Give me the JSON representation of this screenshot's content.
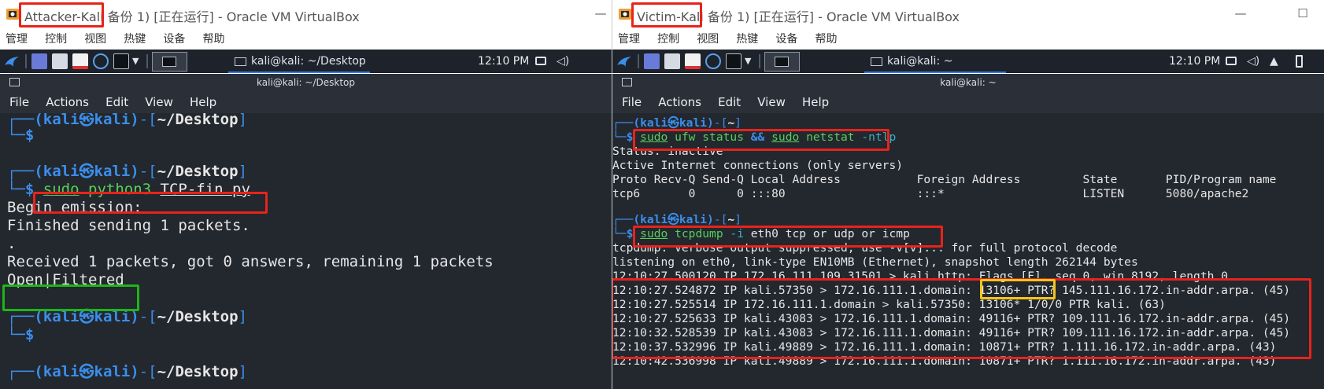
{
  "left_vm": {
    "title_name": "Attacker-Kali",
    "title_rest": " 备份 1) [正在运行] - Oracle VM VirtualBox",
    "menu": [
      "管理",
      "控制",
      "视图",
      "热键",
      "设备",
      "帮助"
    ],
    "panel": {
      "window_tab": "kali@kali: ~/Desktop",
      "clock": "12:10 PM"
    },
    "terminal": {
      "title": "kali@kali: ~/Desktop",
      "menu": [
        "File",
        "Actions",
        "Edit",
        "View",
        "Help"
      ],
      "prompt_user": "(kali㉿kali)",
      "prompt_path": "~/Desktop",
      "prompt_dollar": "$",
      "cmd_sudo": "sudo",
      "cmd_python": " python3 ",
      "cmd_file": "TCP-fin.py",
      "out1": "Begin emission:",
      "out2": "Finished sending 1 packets.",
      "out3": ".",
      "out4": "Received 1 packets, got 0 answers, remaining 1 packets",
      "result": "Open|Filtered"
    }
  },
  "right_vm": {
    "title_name": "Victim-Kali",
    "title_rest": " 备份 1) [正在运行] - Oracle VM VirtualBox",
    "menu": [
      "管理",
      "控制",
      "视图",
      "热键",
      "设备",
      "帮助"
    ],
    "panel": {
      "window_tab": "kali@kali: ~",
      "clock": "12:10 PM"
    },
    "terminal": {
      "title": "kali@kali: ~",
      "menu": [
        "File",
        "Actions",
        "Edit",
        "View",
        "Help"
      ],
      "prompt_user": "(kali㉿kali)",
      "prompt_path": "~",
      "prompt_dollar": "$",
      "cmd1": {
        "sudo1": "sudo",
        "ufw": " ufw status ",
        "amp": "&&",
        "sp": " ",
        "sudo2": "sudo",
        "netstat": " netstat ",
        "flag": "-ntlp"
      },
      "netstat": {
        "status": "Status: inactive",
        "heading": "Active Internet connections (only servers)",
        "header": "Proto Recv-Q Send-Q Local Address           Foreign Address         State       PID/Program name",
        "row": "tcp6       0      0 :::80                   :::*                    LISTEN      5080/apache2"
      },
      "cmd2": {
        "sudo": "sudo",
        "tcpdump": " tcpdump ",
        "flag": "-i",
        "rest": " eth0 tcp or udp or icmp"
      },
      "dump_info1": "tcpdump: verbose output suppressed, use -v[v]... for full protocol decode",
      "dump_info2": "listening on eth0, link-type EN10MB (Ethernet), snapshot length 262144 bytes",
      "packet1_a": "12:10:27.500120 IP 172.16.111.109.31501 > kali.http: ",
      "packet1_flags": "Flags [F]",
      "packet1_b": ", seq 0, win 8192, length 0",
      "packets": [
        "12:10:27.524872 IP kali.57350 > 172.16.111.1.domain: 13106+ PTR? 145.111.16.172.in-addr.arpa. (45)",
        "12:10:27.525514 IP 172.16.111.1.domain > kali.57350: 13106* 1/0/0 PTR kali. (63)",
        "12:10:27.525633 IP kali.43083 > 172.16.111.1.domain: 49116+ PTR? 109.111.16.172.in-addr.arpa. (45)",
        "12:10:32.528539 IP kali.43083 > 172.16.111.1.domain: 49116+ PTR? 109.111.16.172.in-addr.arpa. (45)",
        "12:10:37.532996 IP kali.49889 > 172.16.111.1.domain: 10871+ PTR? 1.111.16.172.in-addr.arpa. (43)",
        "12:10:42.536998 IP kali.49889 > 172.16.111.1.domain: 10871+ PTR? 1.111.16.172.in-addr.arpa. (43)"
      ]
    }
  },
  "colors": {
    "annotation_red": "#e8231c",
    "annotation_green": "#1fb41a",
    "annotation_yellow": "#f5c518",
    "terminal_bg": "#23272e",
    "prompt_blue": "#3b8eea"
  },
  "icons": [
    "virtualbox-icon",
    "kali-dragon-icon",
    "workspace-icon",
    "file-manager-icon",
    "text-editor-icon",
    "browser-icon",
    "terminal-icon",
    "chevron-down-icon",
    "screen-icon",
    "volume-icon",
    "notification-bell-icon",
    "battery-icon",
    "minimize-icon",
    "maximize-icon"
  ]
}
